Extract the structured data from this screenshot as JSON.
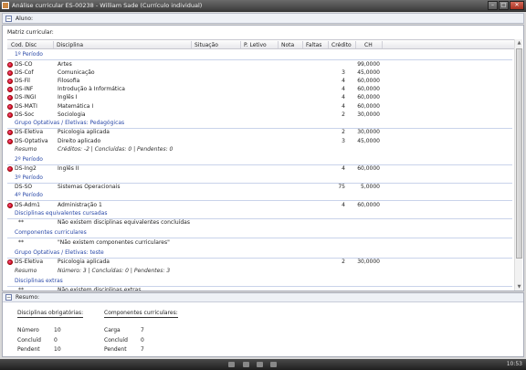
{
  "window": {
    "title": "Análise curricular ES-00238 - William Sade (Currículo individual)"
  },
  "aluno": {
    "label": "Aluno:"
  },
  "matriz": {
    "label": "Matriz curricular:"
  },
  "columns": [
    "Cod. Disc",
    "Disciplina",
    "Situação",
    "P. Letivo",
    "Nota",
    "Faltas",
    "Crédito",
    "CH"
  ],
  "rows": [
    {
      "type": "group",
      "text": "1º Período"
    },
    {
      "type": "disc",
      "icon": "red-status-icon",
      "code": "DS-CO",
      "name": "Artes",
      "credito": "",
      "ch": "99,0000"
    },
    {
      "type": "disc",
      "icon": "red-status-icon",
      "code": "DS-Cof",
      "name": "Comunicação",
      "credito": "3",
      "ch": "45,0000"
    },
    {
      "type": "disc",
      "icon": "red-status-icon",
      "code": "DS-Fil",
      "name": "Filosofia",
      "credito": "4",
      "ch": "60,0000"
    },
    {
      "type": "disc",
      "icon": "red-status-icon",
      "code": "DS-INF",
      "name": "Introdução à Informática",
      "credito": "4",
      "ch": "60,0000"
    },
    {
      "type": "disc",
      "icon": "red-status-icon",
      "code": "DS-INGI",
      "name": "Inglês I",
      "credito": "4",
      "ch": "60,0000"
    },
    {
      "type": "disc",
      "icon": "red-status-icon",
      "code": "DS-MATI",
      "name": "Matemática I",
      "credito": "4",
      "ch": "60,0000"
    },
    {
      "type": "disc",
      "icon": "red-status-icon",
      "code": "DS-Soc",
      "name": "Sociologia",
      "credito": "2",
      "ch": "30,0000"
    },
    {
      "type": "group",
      "text": "Grupo Optativas / Eletivas: Pedagógicas"
    },
    {
      "type": "disc",
      "icon": "red-status-icon",
      "code": "DS-Eletiva",
      "name": "Psicologia aplicada",
      "credito": "2",
      "ch": "30,0000"
    },
    {
      "type": "disc",
      "icon": "red-status-icon",
      "code": "DS-Optativa",
      "name": "Direito aplicado",
      "credito": "3",
      "ch": "45,0000"
    },
    {
      "type": "resumo",
      "label": "Resumo",
      "text": "Créditos: -2 | Concluídas: 0 | Pendentes: 0"
    },
    {
      "type": "group",
      "text": "2º Período"
    },
    {
      "type": "disc",
      "icon": "red-status-icon",
      "code": "DS-Ing2",
      "name": "Inglês II",
      "credito": "4",
      "ch": "60,0000"
    },
    {
      "type": "group",
      "text": "3º Período"
    },
    {
      "type": "disc",
      "icon": "",
      "code": "DS-SO",
      "name": "Sistemas Operacionais",
      "credito": "75",
      "ch": "5,0000"
    },
    {
      "type": "group",
      "text": "4º Período"
    },
    {
      "type": "disc",
      "icon": "red-status-icon",
      "code": "DS-Adm1",
      "name": "Administração 1",
      "credito": "4",
      "ch": "60,0000"
    },
    {
      "type": "group",
      "text": "Disciplinas equivalentes cursadas"
    },
    {
      "type": "note",
      "label": "**",
      "text": "Não existem disciplinas equivalentes concluídas"
    },
    {
      "type": "group",
      "text": "Componentes curriculares"
    },
    {
      "type": "note",
      "label": "**",
      "text": "\"Não existem componentes curriculares\""
    },
    {
      "type": "group",
      "text": "Grupo Optativas / Eletivas: teste"
    },
    {
      "type": "disc",
      "icon": "red-status-icon",
      "code": "DS-Eletiva",
      "name": "Psicologia aplicada",
      "credito": "2",
      "ch": "30,0000"
    },
    {
      "type": "resumo",
      "label": "Resumo",
      "text": "Número: 3 | Concluídas: 0 | Pendentes: 3"
    },
    {
      "type": "group",
      "text": "Disciplinas extras"
    },
    {
      "type": "note",
      "label": "**",
      "text": "Não existem disciplinas extras"
    }
  ],
  "resumo": {
    "title": "Resumo:",
    "obrigatorias": {
      "title": "Disciplinas obrigatórias:",
      "items": [
        {
          "label": "Número",
          "value": "10"
        },
        {
          "label": "Concluíd",
          "value": "0"
        },
        {
          "label": "Pendent",
          "value": "10"
        }
      ]
    },
    "componentes": {
      "title": "Componentes curriculares:",
      "items": [
        {
          "label": "Carga",
          "value": "7"
        },
        {
          "label": "Concluíd",
          "value": "0"
        },
        {
          "label": "Pendent",
          "value": "7"
        }
      ]
    }
  },
  "taskbar": {
    "clock": "10:53"
  }
}
